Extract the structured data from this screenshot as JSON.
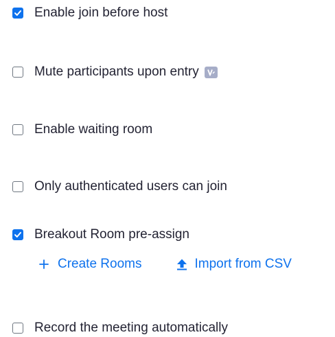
{
  "options": [
    {
      "label": "Enable join before host",
      "checked": true
    },
    {
      "label": "Mute participants upon entry",
      "checked": false,
      "badge_icon": "info-v-icon"
    },
    {
      "label": "Enable waiting room",
      "checked": false
    },
    {
      "label": "Only authenticated users can join",
      "checked": false
    },
    {
      "label": "Breakout Room pre-assign",
      "checked": true
    },
    {
      "label": "Record the meeting automatically",
      "checked": false
    }
  ],
  "breakout_actions": {
    "create_rooms": {
      "label": "Create Rooms",
      "icon": "plus-icon"
    },
    "import_csv": {
      "label": "Import from CSV",
      "icon": "upload-arrow-icon"
    }
  },
  "colors": {
    "accent": "#0e72ed",
    "text": "#232333",
    "checkbox_border": "#6e7680",
    "badge": "#a6adc8"
  }
}
